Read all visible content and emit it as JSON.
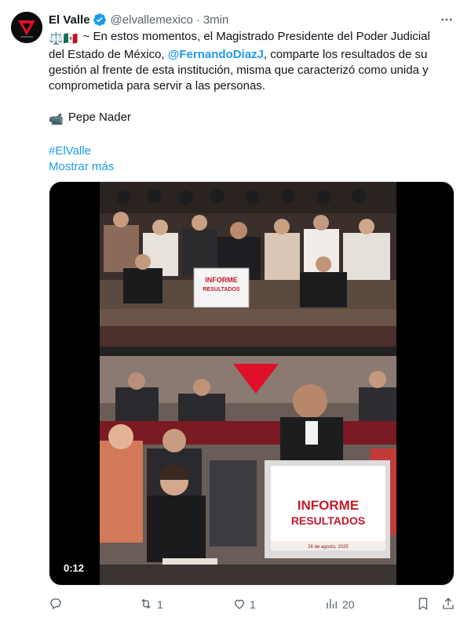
{
  "tweet": {
    "display_name": "El Valle",
    "handle": "@elvallemexico",
    "separator": "·",
    "time": "3min",
    "lines": {
      "l1_emoji": "⚖️🇲🇽",
      "l1_text": " ~ En estos momentos, el Magistrado Presidente del Poder Judicial",
      "l2_before": "del Estado de México, ",
      "l2_mention": "@FernandoDiazJ",
      "l2_after": ", comparte los resultados de su",
      "l3": "gestión al frente de esta institución, misma que caracterizó como unida y",
      "l4": "comprometida para servir a las personas.",
      "credit_emoji": "📹",
      "credit": " Pepe Nader",
      "hashtag": "#ElValle",
      "show_more": "Mostrar más"
    },
    "media": {
      "duration": "0:12",
      "podium_title_top": "INFORME",
      "podium_title_bottom": "RESULTADOS",
      "podium_date": "26 de agosto, 2025",
      "screen_title_top": "INFORME",
      "screen_title_bottom": "RESULTADOS"
    },
    "actions": {
      "reply_count": "",
      "retweet_count": "1",
      "like_count": "1",
      "views_count": "20"
    }
  },
  "colors": {
    "accent": "#1d9bf0",
    "text": "#0f1419",
    "secondary": "#536471",
    "brand_red": "#e0102b"
  }
}
